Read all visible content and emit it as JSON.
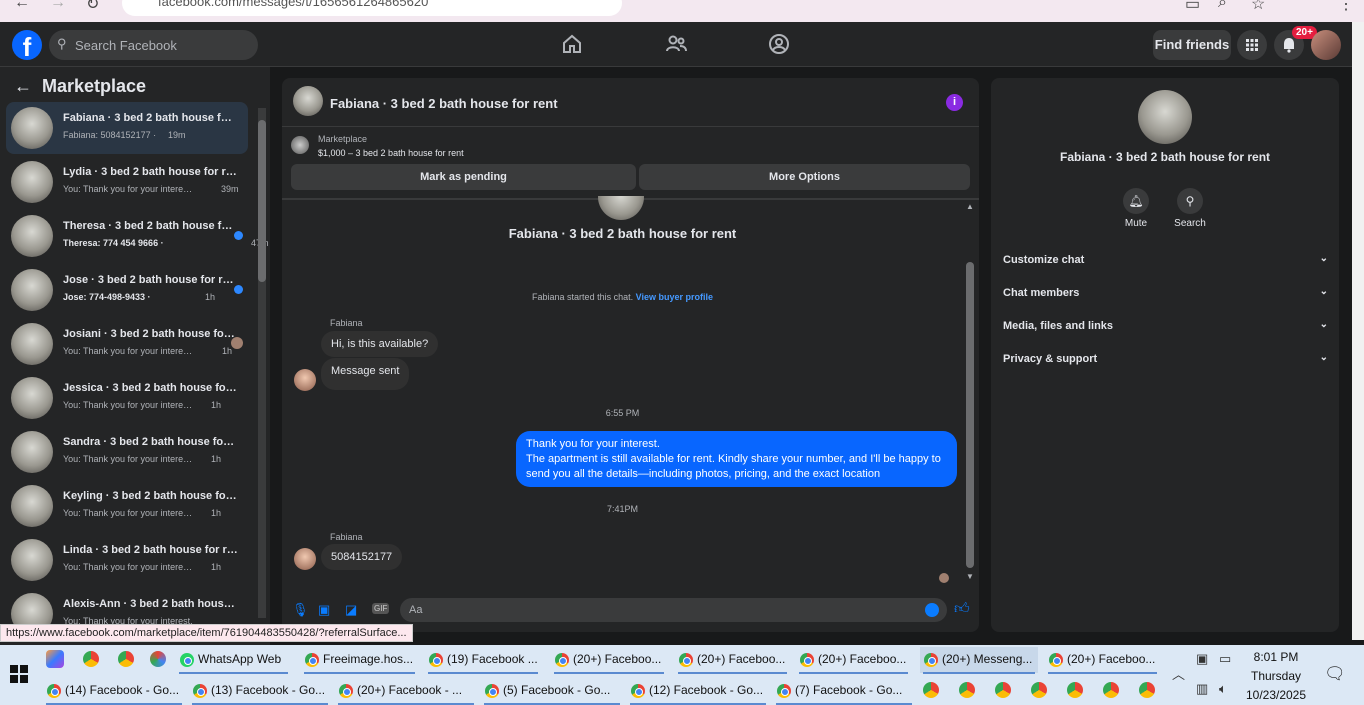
{
  "browser": {
    "url": "facebook.com/messages/t/1656561264865620"
  },
  "header": {
    "logo": "f",
    "search_placeholder": "Search Facebook",
    "find_friends": "Find friends",
    "notif_badge": "20+"
  },
  "sidebar": {
    "title": "Marketplace",
    "conversations": [
      {
        "name": "Fabiana · 3 bed 2 bath house for rent",
        "snippet": "Fabiana: 5084152177 ·",
        "time": "19m",
        "selected": true,
        "unread": false
      },
      {
        "name": "Lydia · 3 bed 2 bath house for rent",
        "snippet": "You: Thank you for your interest....",
        "time": "39m",
        "unread": false
      },
      {
        "name": "Theresa · 3 bed 2 bath house for rent",
        "snippet": "Theresa: 774 454 9666 ·",
        "time": "47m",
        "unread": true
      },
      {
        "name": "Jose · 3 bed 2 bath house for rent",
        "snippet": "Jose: 774-498-9433 ·",
        "time": "1h",
        "unread": true
      },
      {
        "name": "Josiani · 3 bed 2 bath house for rent",
        "snippet": "You: Thank you for your interest...",
        "time": "1h",
        "unread": false
      },
      {
        "name": "Jessica · 3 bed 2 bath house for rent",
        "snippet": "You: Thank you for your interest. T...",
        "time": "1h",
        "unread": false
      },
      {
        "name": "Sandra · 3 bed 2 bath house for rent",
        "snippet": "You: Thank you for your interest. T...",
        "time": "1h",
        "unread": false
      },
      {
        "name": "Keyling · 3 bed 2 bath house for rent",
        "snippet": "You: Thank you for your interest. T...",
        "time": "1h",
        "unread": false
      },
      {
        "name": "Linda · 3 bed 2 bath house for rent",
        "snippet": "You: Thank you for your interest. T...",
        "time": "1h",
        "unread": false
      },
      {
        "name": "Alexis-Ann · 3 bed 2 bath house for rent",
        "snippet": "You: Thank you for your interest.",
        "time": "",
        "unread": false
      }
    ]
  },
  "chat": {
    "title": "Fabiana · 3 bed 2 bath house for rent",
    "marketplace_label": "Marketplace",
    "listing": "$1,000 – 3 bed 2 bath house for rent",
    "mark_pending": "Mark as pending",
    "more_options": "More Options",
    "profile_name": "Fabiana · 3 bed 2 bath house for rent",
    "started_text": "Fabiana started this chat.",
    "view_buyer_profile": "View buyer profile",
    "sender1": "Fabiana",
    "msg1": "Hi, is this available?",
    "msg2": "Message sent",
    "time1": "6:55 PM",
    "out_line1": "Thank you for your interest.",
    "out_line2": "The apartment is still available for rent. Kindly share your number, and I'll be happy to send you all the details—including photos, pricing, and the exact location",
    "time2": "7:41PM",
    "sender2": "Fabiana",
    "msg3": "5084152177",
    "composer_placeholder": "Aa"
  },
  "details": {
    "name": "Fabiana · 3 bed 2 bath house for rent",
    "mute": "Mute",
    "search": "Search",
    "sections": [
      "Customize chat",
      "Chat members",
      "Media, files and links",
      "Privacy & support"
    ]
  },
  "status_url": "https://www.facebook.com/marketplace/item/761904483550428/?referralSurface...",
  "taskbar": {
    "row1": [
      "WhatsApp Web",
      "Freeimage.hos...",
      "(19) Facebook ...",
      "(20+) Faceboo...",
      "(20+) Faceboo...",
      "(20+) Faceboo...",
      "(20+) Messeng...",
      "(20+) Faceboo..."
    ],
    "row2": [
      "(14) Facebook - Go...",
      "(13) Facebook - Go...",
      "(20+) Facebook - ...",
      "(5) Facebook - Go...",
      "(12) Facebook - Go...",
      "(7) Facebook - Go..."
    ],
    "time": "8:01 PM",
    "day": "Thursday",
    "date": "10/23/2025"
  },
  "colors": {
    "accent": "#0866ff",
    "bg": "#18191a",
    "panel": "#242526",
    "unread_dot": "#2d88ff"
  }
}
